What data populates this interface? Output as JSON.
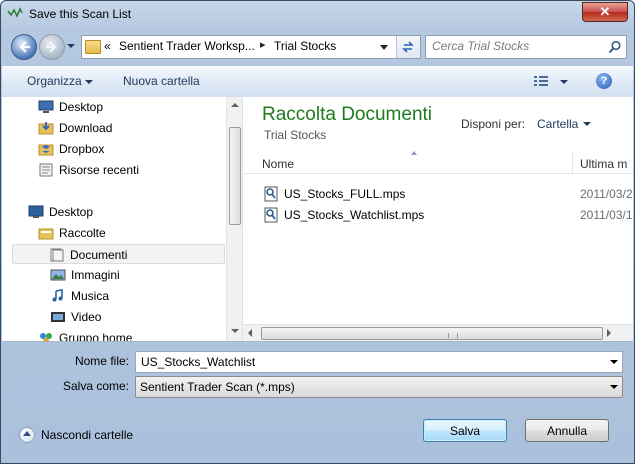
{
  "window": {
    "title": "Save this Scan List",
    "close_label": "✕"
  },
  "address": {
    "prefix": "«",
    "crumbs": [
      "Sentient Trader Worksp...",
      "Trial Stocks"
    ],
    "separator": "▸"
  },
  "search": {
    "placeholder": "Cerca Trial Stocks"
  },
  "toolbar": {
    "organize_label": "Organizza",
    "new_folder_label": "Nuova cartella",
    "help_label": "?"
  },
  "nav_items": [
    {
      "label": "Desktop",
      "icon": "desktop-icon"
    },
    {
      "label": "Download",
      "icon": "download-folder-icon"
    },
    {
      "label": "Dropbox",
      "icon": "dropbox-icon"
    },
    {
      "label": "Risorse recenti",
      "icon": "recent-places-icon"
    },
    {
      "label": "Desktop",
      "icon": "desktop-icon"
    },
    {
      "label": "Raccolte",
      "icon": "libraries-icon"
    },
    {
      "label": "Documenti",
      "icon": "documents-icon",
      "selected": true
    },
    {
      "label": "Immagini",
      "icon": "pictures-icon"
    },
    {
      "label": "Musica",
      "icon": "music-icon"
    },
    {
      "label": "Video",
      "icon": "video-icon"
    },
    {
      "label": "Gruppo home",
      "icon": "homegroup-icon"
    }
  ],
  "library": {
    "title": "Raccolta Documenti",
    "subtitle": "Trial Stocks",
    "arrange_label": "Disponi per:",
    "arrange_value": "Cartella"
  },
  "columns": {
    "name": "Nome",
    "date": "Ultima m"
  },
  "files": [
    {
      "name": "US_Stocks_FULL.mps",
      "date": "2011/03/2"
    },
    {
      "name": "US_Stocks_Watchlist.mps",
      "date": "2011/03/1"
    }
  ],
  "form": {
    "filename_label": "Nome file:",
    "filename_value": "US_Stocks_Watchlist",
    "filetype_label": "Salva come:",
    "filetype_value": "Sentient Trader Scan (*.mps)"
  },
  "footer": {
    "hide_folders_label": "Nascondi cartelle",
    "save_label": "Salva",
    "cancel_label": "Annulla"
  }
}
